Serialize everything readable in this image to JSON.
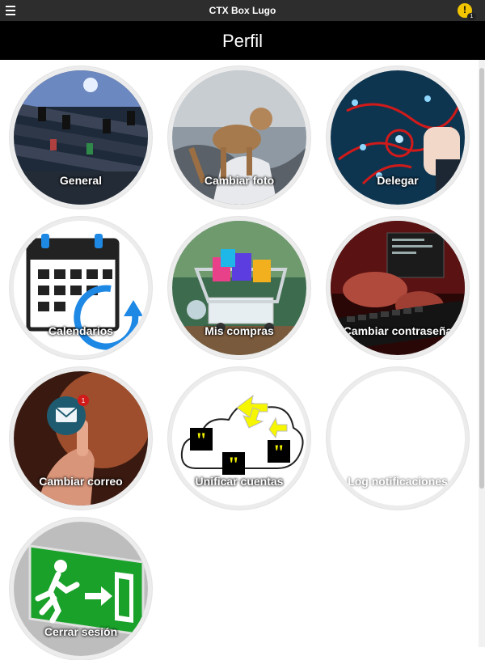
{
  "topbar": {
    "app_title": "CTX Box Lugo",
    "alert_badge": "1"
  },
  "header": {
    "title": "Perfil"
  },
  "tiles": [
    {
      "label": "General"
    },
    {
      "label": "Cambiar foto"
    },
    {
      "label": "Delegar"
    },
    {
      "label": "Calendarios"
    },
    {
      "label": "Mis compras"
    },
    {
      "label": "Cambiar contraseña"
    },
    {
      "label": "Cambiar correo",
      "badge": "1"
    },
    {
      "label": "Unificar cuentas"
    },
    {
      "label": "Log notificaciones"
    },
    {
      "label": "Cerrar sesión"
    }
  ],
  "icons": {
    "menu": "hamburger-menu-icon",
    "alert": "alert-icon",
    "mail": "mail-icon"
  },
  "colors": {
    "topbar": "#2d2d2d",
    "header": "#000000",
    "alert": "#f2c500",
    "exit_sign": "#1aa12a"
  }
}
